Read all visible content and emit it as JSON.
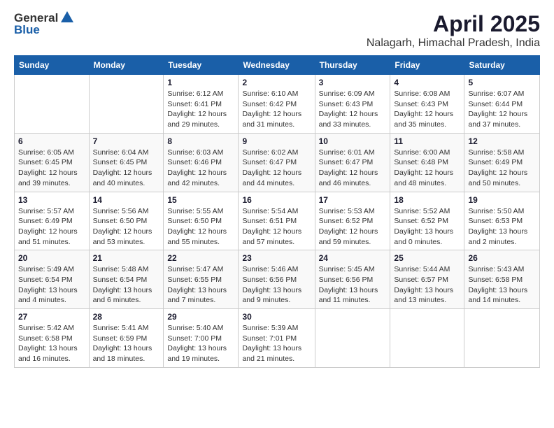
{
  "app": {
    "logo_general": "General",
    "logo_blue": "Blue"
  },
  "header": {
    "title": "April 2025",
    "subtitle": "Nalagarh, Himachal Pradesh, India"
  },
  "calendar": {
    "days_of_week": [
      "Sunday",
      "Monday",
      "Tuesday",
      "Wednesday",
      "Thursday",
      "Friday",
      "Saturday"
    ],
    "weeks": [
      [
        {
          "day": "",
          "info": ""
        },
        {
          "day": "",
          "info": ""
        },
        {
          "day": "1",
          "info": "Sunrise: 6:12 AM\nSunset: 6:41 PM\nDaylight: 12 hours\nand 29 minutes."
        },
        {
          "day": "2",
          "info": "Sunrise: 6:10 AM\nSunset: 6:42 PM\nDaylight: 12 hours\nand 31 minutes."
        },
        {
          "day": "3",
          "info": "Sunrise: 6:09 AM\nSunset: 6:43 PM\nDaylight: 12 hours\nand 33 minutes."
        },
        {
          "day": "4",
          "info": "Sunrise: 6:08 AM\nSunset: 6:43 PM\nDaylight: 12 hours\nand 35 minutes."
        },
        {
          "day": "5",
          "info": "Sunrise: 6:07 AM\nSunset: 6:44 PM\nDaylight: 12 hours\nand 37 minutes."
        }
      ],
      [
        {
          "day": "6",
          "info": "Sunrise: 6:05 AM\nSunset: 6:45 PM\nDaylight: 12 hours\nand 39 minutes."
        },
        {
          "day": "7",
          "info": "Sunrise: 6:04 AM\nSunset: 6:45 PM\nDaylight: 12 hours\nand 40 minutes."
        },
        {
          "day": "8",
          "info": "Sunrise: 6:03 AM\nSunset: 6:46 PM\nDaylight: 12 hours\nand 42 minutes."
        },
        {
          "day": "9",
          "info": "Sunrise: 6:02 AM\nSunset: 6:47 PM\nDaylight: 12 hours\nand 44 minutes."
        },
        {
          "day": "10",
          "info": "Sunrise: 6:01 AM\nSunset: 6:47 PM\nDaylight: 12 hours\nand 46 minutes."
        },
        {
          "day": "11",
          "info": "Sunrise: 6:00 AM\nSunset: 6:48 PM\nDaylight: 12 hours\nand 48 minutes."
        },
        {
          "day": "12",
          "info": "Sunrise: 5:58 AM\nSunset: 6:49 PM\nDaylight: 12 hours\nand 50 minutes."
        }
      ],
      [
        {
          "day": "13",
          "info": "Sunrise: 5:57 AM\nSunset: 6:49 PM\nDaylight: 12 hours\nand 51 minutes."
        },
        {
          "day": "14",
          "info": "Sunrise: 5:56 AM\nSunset: 6:50 PM\nDaylight: 12 hours\nand 53 minutes."
        },
        {
          "day": "15",
          "info": "Sunrise: 5:55 AM\nSunset: 6:50 PM\nDaylight: 12 hours\nand 55 minutes."
        },
        {
          "day": "16",
          "info": "Sunrise: 5:54 AM\nSunset: 6:51 PM\nDaylight: 12 hours\nand 57 minutes."
        },
        {
          "day": "17",
          "info": "Sunrise: 5:53 AM\nSunset: 6:52 PM\nDaylight: 12 hours\nand 59 minutes."
        },
        {
          "day": "18",
          "info": "Sunrise: 5:52 AM\nSunset: 6:52 PM\nDaylight: 13 hours\nand 0 minutes."
        },
        {
          "day": "19",
          "info": "Sunrise: 5:50 AM\nSunset: 6:53 PM\nDaylight: 13 hours\nand 2 minutes."
        }
      ],
      [
        {
          "day": "20",
          "info": "Sunrise: 5:49 AM\nSunset: 6:54 PM\nDaylight: 13 hours\nand 4 minutes."
        },
        {
          "day": "21",
          "info": "Sunrise: 5:48 AM\nSunset: 6:54 PM\nDaylight: 13 hours\nand 6 minutes."
        },
        {
          "day": "22",
          "info": "Sunrise: 5:47 AM\nSunset: 6:55 PM\nDaylight: 13 hours\nand 7 minutes."
        },
        {
          "day": "23",
          "info": "Sunrise: 5:46 AM\nSunset: 6:56 PM\nDaylight: 13 hours\nand 9 minutes."
        },
        {
          "day": "24",
          "info": "Sunrise: 5:45 AM\nSunset: 6:56 PM\nDaylight: 13 hours\nand 11 minutes."
        },
        {
          "day": "25",
          "info": "Sunrise: 5:44 AM\nSunset: 6:57 PM\nDaylight: 13 hours\nand 13 minutes."
        },
        {
          "day": "26",
          "info": "Sunrise: 5:43 AM\nSunset: 6:58 PM\nDaylight: 13 hours\nand 14 minutes."
        }
      ],
      [
        {
          "day": "27",
          "info": "Sunrise: 5:42 AM\nSunset: 6:58 PM\nDaylight: 13 hours\nand 16 minutes."
        },
        {
          "day": "28",
          "info": "Sunrise: 5:41 AM\nSunset: 6:59 PM\nDaylight: 13 hours\nand 18 minutes."
        },
        {
          "day": "29",
          "info": "Sunrise: 5:40 AM\nSunset: 7:00 PM\nDaylight: 13 hours\nand 19 minutes."
        },
        {
          "day": "30",
          "info": "Sunrise: 5:39 AM\nSunset: 7:01 PM\nDaylight: 13 hours\nand 21 minutes."
        },
        {
          "day": "",
          "info": ""
        },
        {
          "day": "",
          "info": ""
        },
        {
          "day": "",
          "info": ""
        }
      ]
    ]
  }
}
